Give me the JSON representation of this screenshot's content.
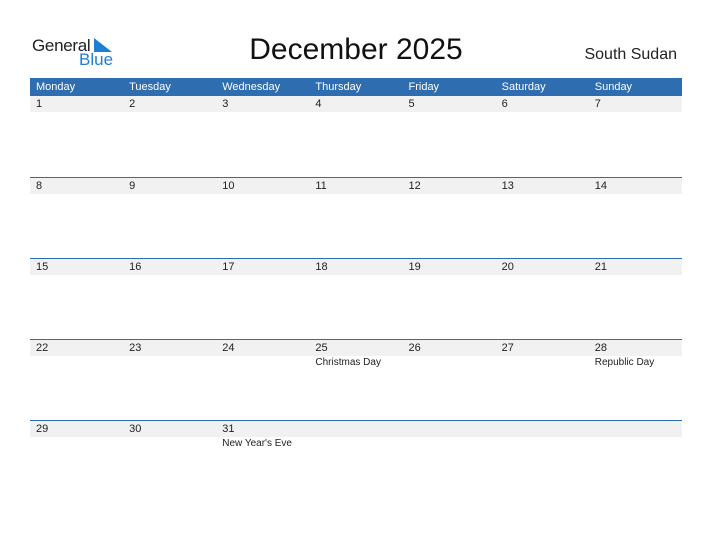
{
  "logo": {
    "line1": "General",
    "line2": "Blue"
  },
  "title": "December 2025",
  "country": "South Sudan",
  "weekdays": [
    "Monday",
    "Tuesday",
    "Wednesday",
    "Thursday",
    "Friday",
    "Saturday",
    "Sunday"
  ],
  "weeks": [
    {
      "days": [
        "1",
        "2",
        "3",
        "4",
        "5",
        "6",
        "7"
      ],
      "events": [
        "",
        "",
        "",
        "",
        "",
        "",
        ""
      ]
    },
    {
      "days": [
        "8",
        "9",
        "10",
        "11",
        "12",
        "13",
        "14"
      ],
      "events": [
        "",
        "",
        "",
        "",
        "",
        "",
        ""
      ]
    },
    {
      "days": [
        "15",
        "16",
        "17",
        "18",
        "19",
        "20",
        "21"
      ],
      "events": [
        "",
        "",
        "",
        "",
        "",
        "",
        ""
      ]
    },
    {
      "days": [
        "22",
        "23",
        "24",
        "25",
        "26",
        "27",
        "28"
      ],
      "events": [
        "",
        "",
        "",
        "Christmas Day",
        "",
        "",
        "Republic Day"
      ]
    },
    {
      "days": [
        "29",
        "30",
        "31",
        "",
        "",
        "",
        ""
      ],
      "events": [
        "",
        "",
        "New Year's Eve",
        "",
        "",
        "",
        ""
      ]
    }
  ],
  "colors": {
    "header": "#2d6db0",
    "brand_blue": "#1f7fd1",
    "day_row_bg": "#f1f1f1"
  }
}
